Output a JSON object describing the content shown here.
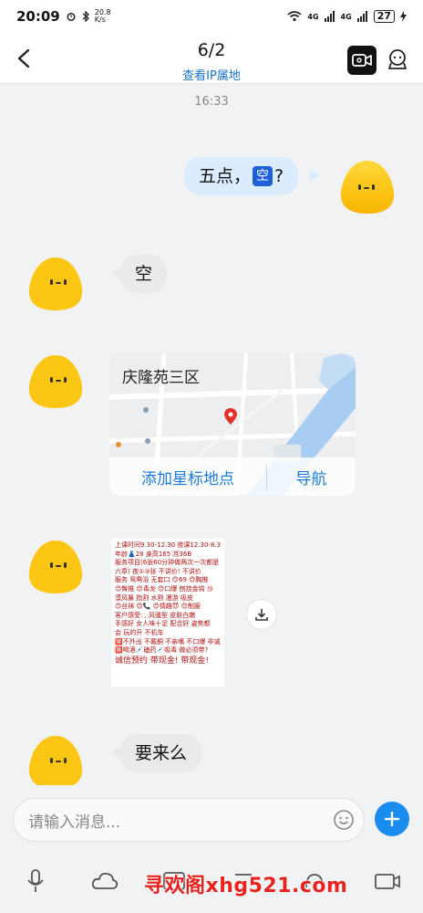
{
  "status_bar": {
    "time": "20:09",
    "net_speed": "20.8\nK/s",
    "signal_1": "4G",
    "signal_2": "4G",
    "battery": "27"
  },
  "header": {
    "title": "6/2",
    "subtitle": "查看IP属地"
  },
  "chat": {
    "time_divider": "16:33",
    "messages": [
      {
        "side": "out",
        "text_before": "五点，",
        "emoji_label": "空",
        "text_after": "?"
      },
      {
        "side": "in",
        "text": "空"
      },
      {
        "side": "in",
        "type": "location",
        "place_name": "庆隆苑三区",
        "action_primary": "添加星标地点",
        "action_secondary": "导航"
      },
      {
        "side": "in",
        "type": "image"
      },
      {
        "side": "in",
        "text": "要来么"
      }
    ],
    "ad_image_lines": [
      "上课时间9.30-12.30 夜课12.30-8.30",
      "年龄👗28    身高165    🈷36B",
      "服务项目(6张60分钟做两次一次都是",
      "六章)  夜①③张   不讲价!  不讲价",
      "服务   鸳鸯浴  无套口  😊69  😊胸推",
      "😊臀推  😊毒龙  😊口爆  刨挂金钩 沙",
      "漠风暴      指割  水割   漫游  吸皮",
      "😊丝袜 😊📞 😊情趣😈 😊制服",
      "客户感受:  , 风骚型        皮肤白嫩",
      "手感好 女人味十足    配合好 姿势都",
      "会           玩的开          不机车",
      "🈲不外出 不戴酮 不亲嘴 不口爆 非诚勿扰",
      "🈲喝酒💉磕药💉吸毒  做必须带?",
      "诚信预约  带现金!  带现金!"
    ]
  },
  "composer": {
    "input_placeholder": "请输入消息..."
  },
  "watermark": "寻欢阁xhg521.com",
  "colors": {
    "accent": "#1a8cf0",
    "outgoing_bubble": "#dcecff",
    "incoming_bubble": "#e9eaec",
    "link": "#1b7ad8"
  },
  "icons": {
    "back": "back-arrow-icon",
    "video": "video-call-icon",
    "profile": "profile-icon",
    "emoji": "smiley-icon",
    "add": "plus-icon",
    "download": "download-icon",
    "toolbar": [
      "microphone-icon",
      "cloud-icon",
      "image-icon",
      "camera-icon",
      "red-packet-icon",
      "gif-icon"
    ]
  }
}
